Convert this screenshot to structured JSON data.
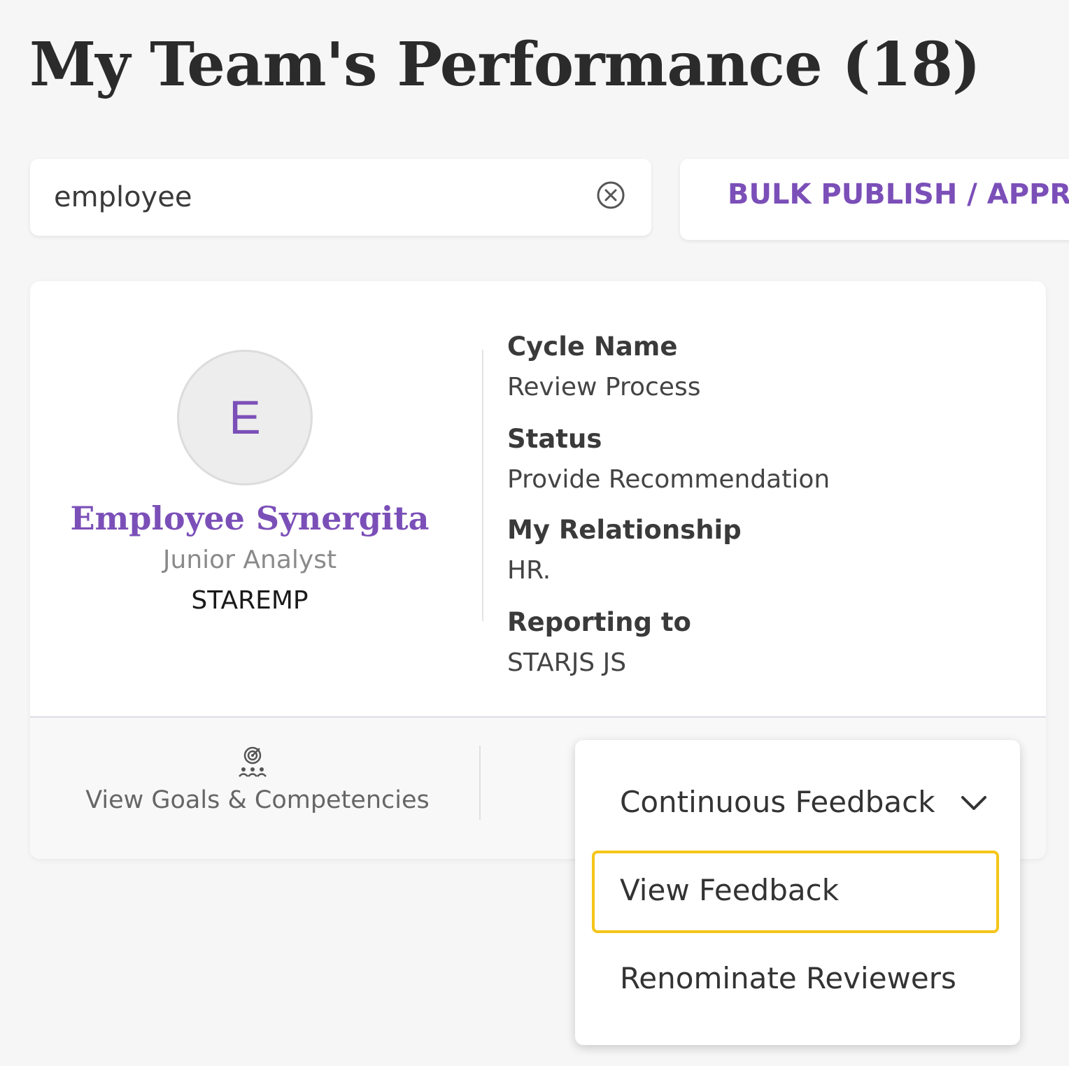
{
  "header": {
    "title": "My Team's Performance (18)"
  },
  "search": {
    "value": "employee",
    "clear_icon": "close-circle-icon"
  },
  "toolbar": {
    "bulk_label": "BULK PUBLISH / APPRO"
  },
  "colors": {
    "accent": "#7b4fb8",
    "highlight": "#f5c518"
  },
  "employee": {
    "initial": "E",
    "name": "Employee Synergita",
    "title": "Junior Analyst",
    "code": "STAREMP"
  },
  "details": {
    "cycle_label": "Cycle Name",
    "cycle_value": "Review Process",
    "status_label": "Status",
    "status_value": "Provide Recommendation",
    "relationship_label": "My Relationship",
    "relationship_value": "HR.",
    "reporting_label": "Reporting to",
    "reporting_value": "STARJS JS"
  },
  "footer": {
    "goals_label": "View Goals & Competencies",
    "goals_icon": "goals-target-team-icon"
  },
  "dropdown": {
    "header_label": "Continuous Feedback",
    "header_icon": "chevron-down-icon",
    "items": [
      {
        "label": "View Feedback",
        "highlighted": true
      },
      {
        "label": "Renominate Reviewers",
        "highlighted": false
      }
    ]
  }
}
